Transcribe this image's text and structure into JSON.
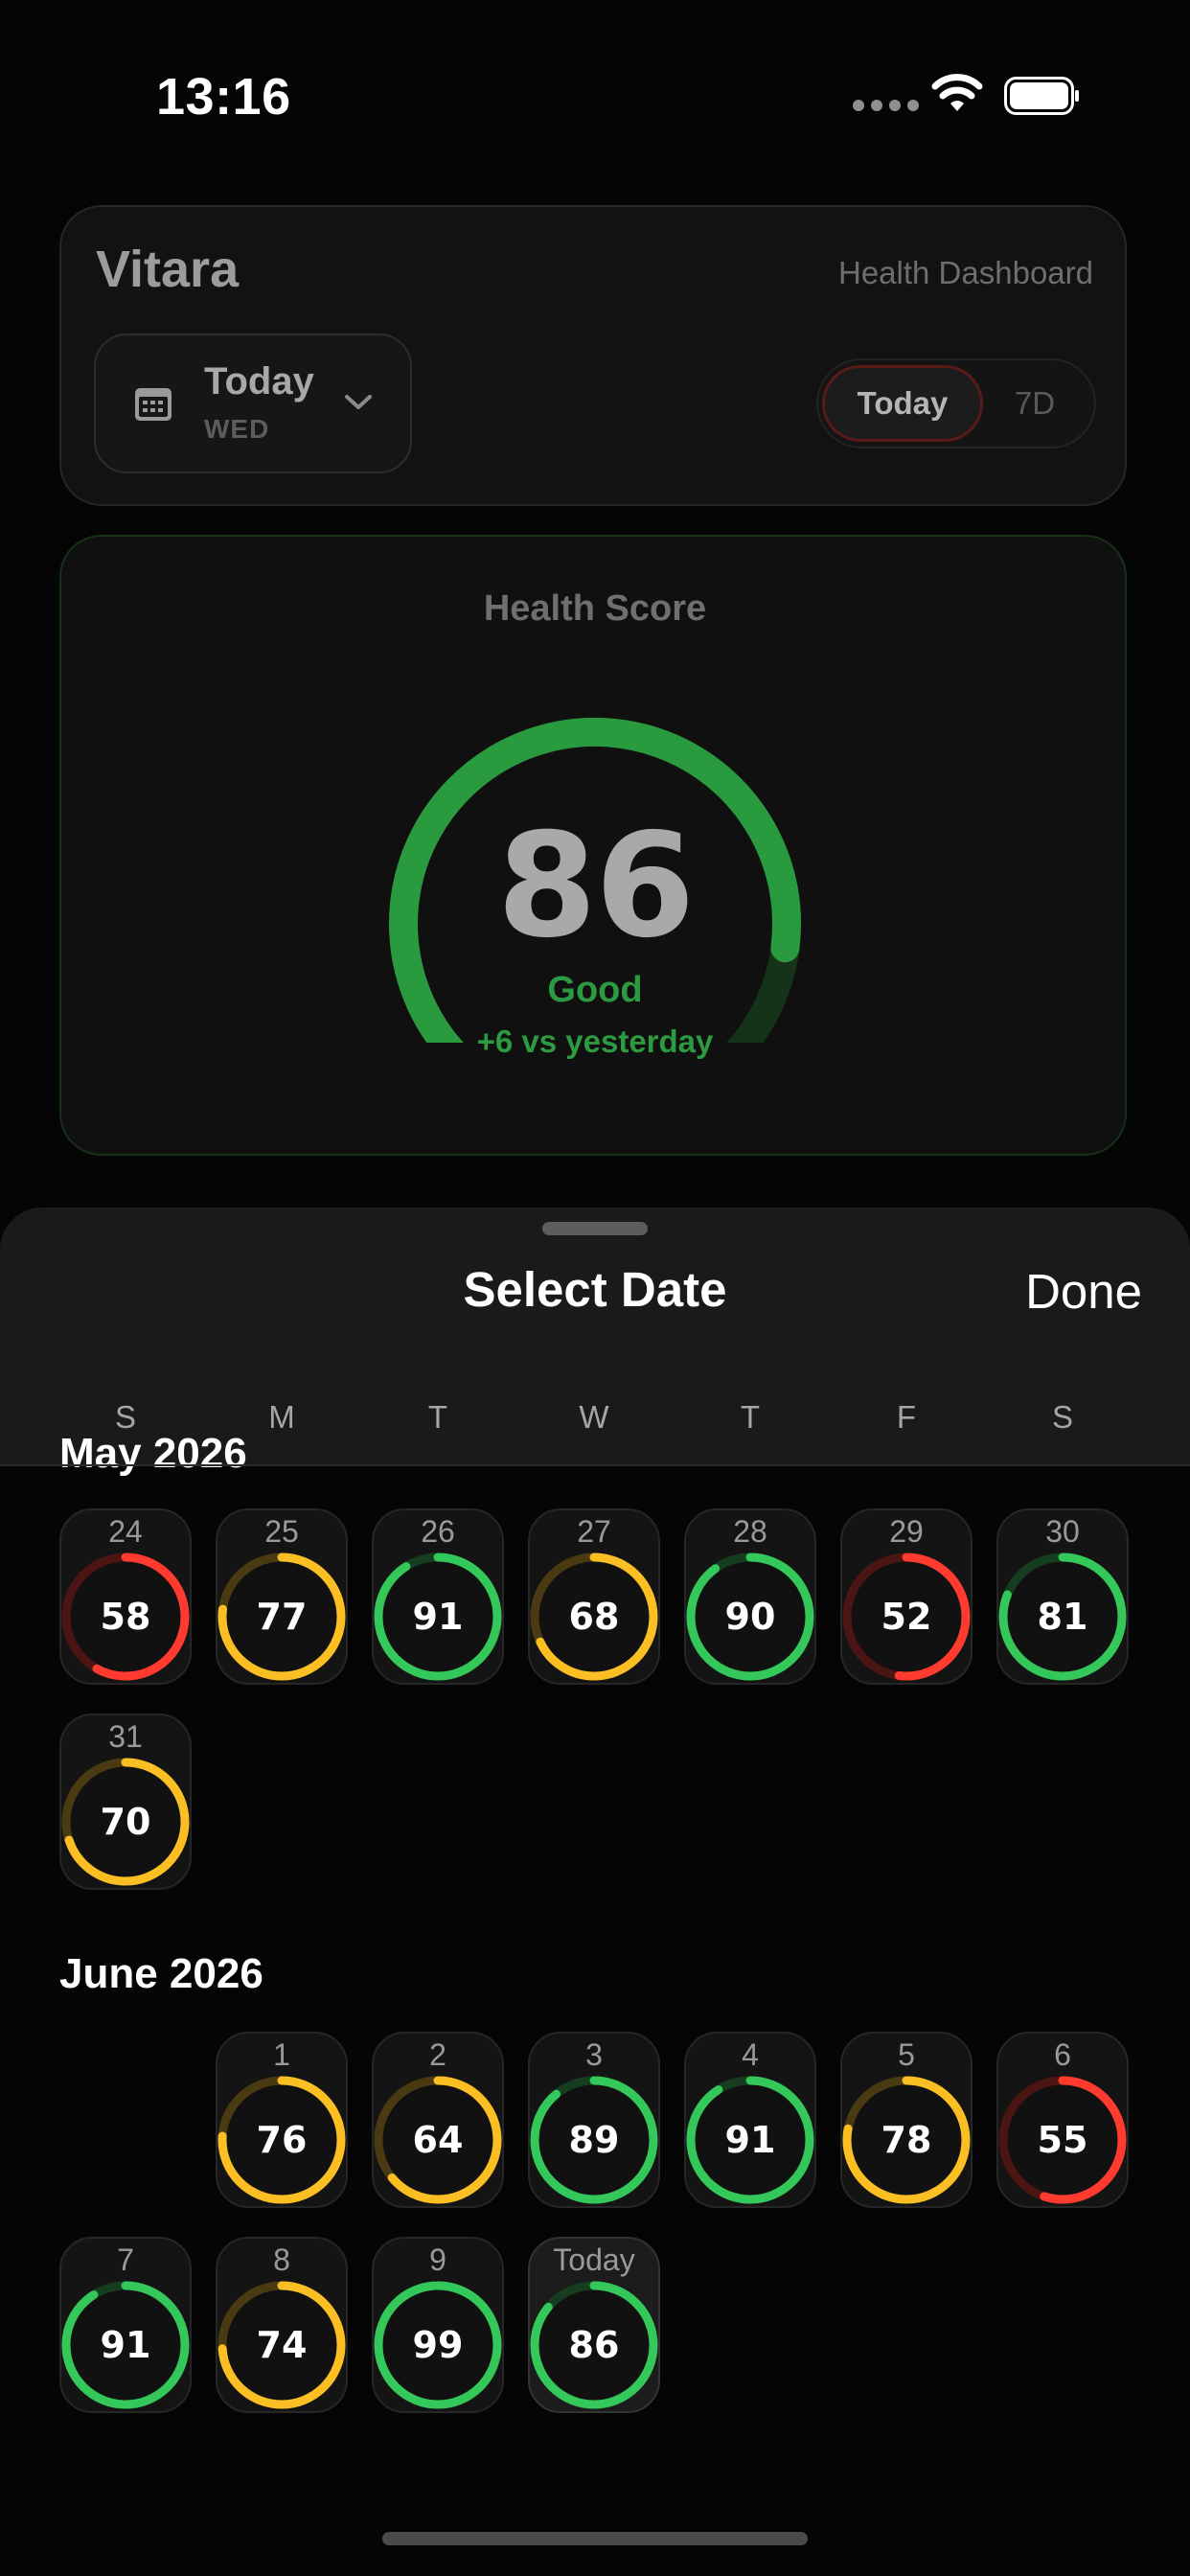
{
  "status_bar": {
    "time": "13:16",
    "icons": [
      "signal-icon",
      "wifi-icon",
      "battery-icon"
    ]
  },
  "header": {
    "app_title": "Vitara",
    "dashboard_label": "Health Dashboard",
    "date_picker": {
      "title": "Today",
      "subtitle": "WED",
      "icon": "calendar-icon",
      "chevron": "chevron-down-icon"
    },
    "segments": [
      {
        "label": "Today",
        "selected": true
      },
      {
        "label": "7D",
        "selected": false
      }
    ]
  },
  "health_score": {
    "title": "Health Score",
    "score": "86",
    "score_value": 86,
    "status": "Good",
    "change": "+6 vs yesterday"
  },
  "sheet": {
    "title": "Select Date",
    "done_label": "Done",
    "weekdays": [
      "S",
      "M",
      "T",
      "W",
      "T",
      "F",
      "S"
    ],
    "peek_month": "May 2026",
    "months": [
      {
        "label": "",
        "days": [
          {
            "day": "24",
            "score": 58,
            "col": 0,
            "row": 0
          },
          {
            "day": "25",
            "score": 77,
            "col": 1,
            "row": 0
          },
          {
            "day": "26",
            "score": 91,
            "col": 2,
            "row": 0
          },
          {
            "day": "27",
            "score": 68,
            "col": 3,
            "row": 0
          },
          {
            "day": "28",
            "score": 90,
            "col": 4,
            "row": 0
          },
          {
            "day": "29",
            "score": 52,
            "col": 5,
            "row": 0
          },
          {
            "day": "30",
            "score": 81,
            "col": 6,
            "row": 0
          },
          {
            "day": "31",
            "score": 70,
            "col": 0,
            "row": 1
          }
        ]
      },
      {
        "label": "June 2026",
        "days": [
          {
            "day": "1",
            "score": 76,
            "col": 1,
            "row": 0
          },
          {
            "day": "2",
            "score": 64,
            "col": 2,
            "row": 0
          },
          {
            "day": "3",
            "score": 89,
            "col": 3,
            "row": 0
          },
          {
            "day": "4",
            "score": 91,
            "col": 4,
            "row": 0
          },
          {
            "day": "5",
            "score": 78,
            "col": 5,
            "row": 0
          },
          {
            "day": "6",
            "score": 55,
            "col": 6,
            "row": 0
          },
          {
            "day": "7",
            "score": 91,
            "col": 0,
            "row": 1
          },
          {
            "day": "8",
            "score": 74,
            "col": 1,
            "row": 1
          },
          {
            "day": "9",
            "score": 99,
            "col": 2,
            "row": 1
          },
          {
            "day": "Today",
            "score": 86,
            "col": 3,
            "row": 1,
            "today": true
          }
        ]
      }
    ]
  },
  "colors": {
    "good": "#34c759",
    "fair": "#fbbf24",
    "poor": "#ff3b30",
    "gauge_green": "#2a9a3e"
  }
}
